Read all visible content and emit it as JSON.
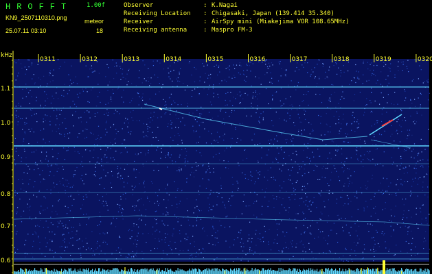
{
  "header": {
    "app_title": "HROFFT",
    "version": "1.00f",
    "filename": "KN9_2507110310.png",
    "meteor_label": "meteor",
    "date": "25.07.11 03:10",
    "meteor_count": "18"
  },
  "info": [
    {
      "key": "Observer",
      "value": "K.Nagai"
    },
    {
      "key": "Receiving Location",
      "value": "Chigasaki, Japan (139.414 35.340)"
    },
    {
      "key": "Receiver",
      "value": "AirSpy mini (Miakejima VOR 108.65MHz)"
    },
    {
      "key": "Receiving antenna",
      "value": "Maspro FM-3"
    }
  ],
  "axis": {
    "y_unit": "kHz",
    "y_ticks": [
      "1.1",
      "1.0",
      "0.9",
      "0.8",
      "0.7",
      "0.6"
    ],
    "x_ticks": [
      "0311",
      "0312",
      "0313",
      "0314",
      "0315",
      "0316",
      "0317",
      "0318",
      "0319",
      "0320"
    ]
  },
  "colors": {
    "background": "#000000",
    "header_text": "#ffff33",
    "title_text": "#33ff33",
    "noise_base": "#0a1460",
    "carrier": "#5fd8ff",
    "tick": "#ffff33",
    "meteor_head": "#ff3a3a"
  }
}
